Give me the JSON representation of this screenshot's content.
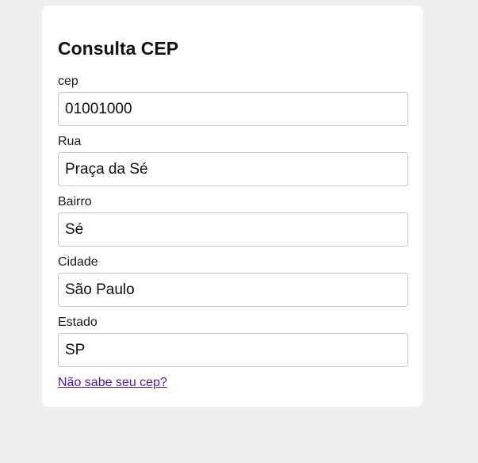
{
  "form": {
    "title": "Consulta CEP",
    "fields": [
      {
        "label": "cep",
        "value": "01001000"
      },
      {
        "label": "Rua",
        "value": "Praça da Sé"
      },
      {
        "label": "Bairro",
        "value": "Sé"
      },
      {
        "label": "Cidade",
        "value": "São Paulo"
      },
      {
        "label": "Estado",
        "value": "SP"
      }
    ],
    "help_link": "Não sabe seu cep?"
  },
  "colors": {
    "page_background": "#efefef",
    "card_background": "#ffffff",
    "link": "#551a8b",
    "input_border": "#c6c6c6"
  }
}
